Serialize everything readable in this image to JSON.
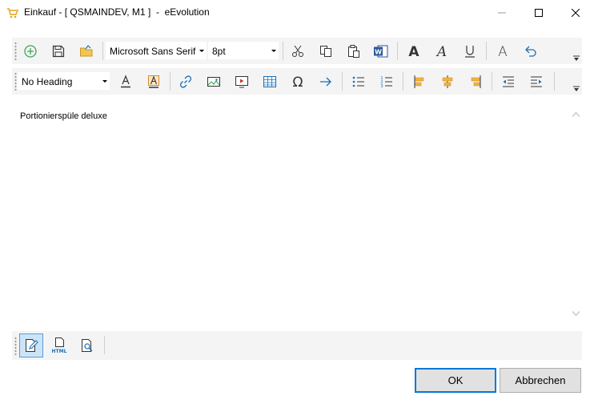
{
  "window": {
    "title": "Einkauf - [ QSMAINDEV, M1 ]  -  eEvolution",
    "icon": "shopping-cart-icon"
  },
  "toolbar1": {
    "font_name": "Microsoft Sans Serif",
    "font_size": "8pt",
    "buttons": [
      "new-document-icon",
      "save-icon",
      "open-folder-icon",
      "cut-icon",
      "copy-icon",
      "paste-icon",
      "word-icon",
      "bold-font-icon",
      "italic-font-icon",
      "underline-icon",
      "clear-format-icon",
      "undo-icon"
    ]
  },
  "toolbar2": {
    "heading": "No Heading",
    "buttons": [
      "font-color-icon",
      "highlight-color-icon",
      "link-icon",
      "image-icon",
      "video-icon",
      "table-icon",
      "omega-special-char-icon",
      "arrow-right-icon",
      "bullet-list-icon",
      "numbered-list-icon",
      "align-left-icon",
      "align-center-icon",
      "align-right-icon",
      "outdent-icon",
      "indent-icon"
    ]
  },
  "editor": {
    "content": "Portionierspüle deluxe"
  },
  "viewbar": {
    "html_label": "HTML"
  },
  "dialog": {
    "ok_label": "OK",
    "cancel_label": "Abbrechen"
  },
  "colors": {
    "accent": "#0078d7",
    "toolbar_bg": "#f4f4f4",
    "icon_blue": "#1a6fb5",
    "icon_green": "#3aa655"
  }
}
